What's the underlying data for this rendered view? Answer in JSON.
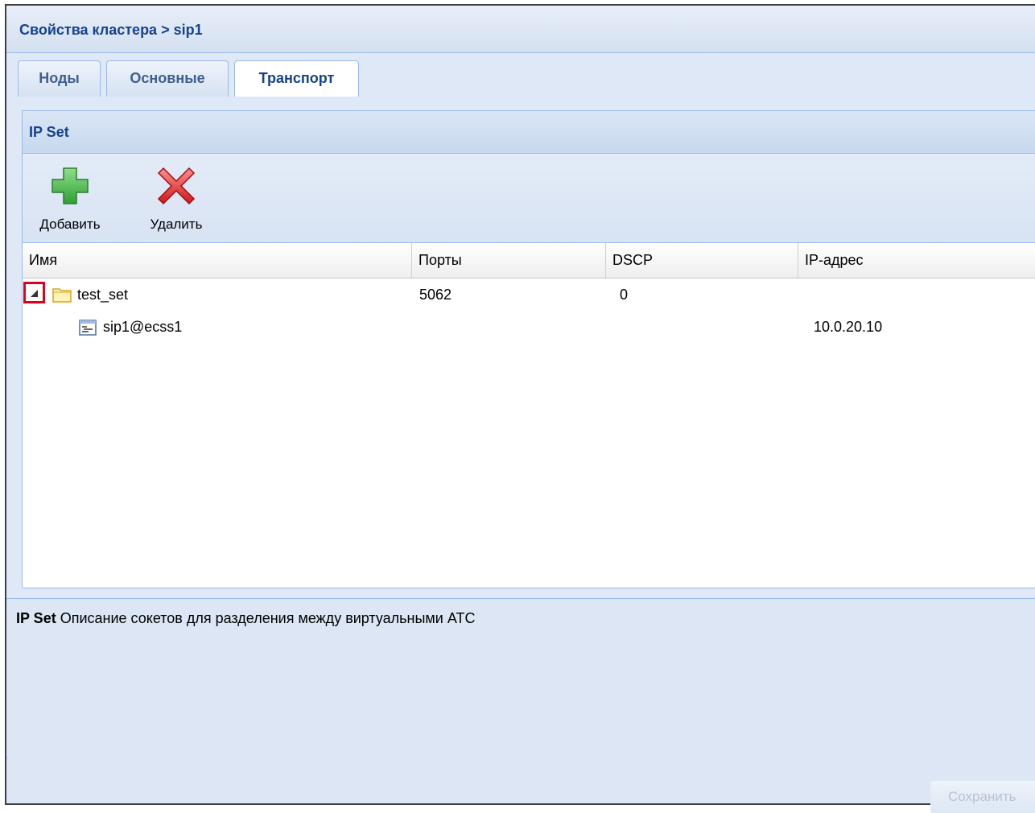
{
  "window": {
    "title": "Свойства кластера > sip1"
  },
  "tabs": [
    {
      "label": "Ноды",
      "active": false
    },
    {
      "label": "Основные",
      "active": false
    },
    {
      "label": "Транспорт",
      "active": true
    }
  ],
  "ipset_panel": {
    "title": "IP Set",
    "toolbar": {
      "add_label": "Добавить",
      "add_icon": "plus-icon",
      "delete_label": "Удалить",
      "delete_icon": "delete-x-icon"
    },
    "grid": {
      "columns": [
        "Имя",
        "Порты",
        "DSCP",
        "IP-адрес"
      ],
      "rows": [
        {
          "name": "test_set",
          "ports": "5062",
          "dscp": "0",
          "ip": "",
          "type": "folder",
          "expanded": true
        },
        {
          "name": "sip1@ecss1",
          "ports": "",
          "dscp": "",
          "ip": "10.0.20.10",
          "type": "node"
        }
      ]
    }
  },
  "description": {
    "title": "IP Set",
    "text": "Описание сокетов для разделения между виртуальными АТС"
  },
  "footer": {
    "save_label": "Сохранить",
    "save_enabled": false
  },
  "colors": {
    "header_text": "#15428b",
    "panel_bg": "#dfe8f6",
    "border": "#99bbe8",
    "highlight": "#e0001a"
  }
}
